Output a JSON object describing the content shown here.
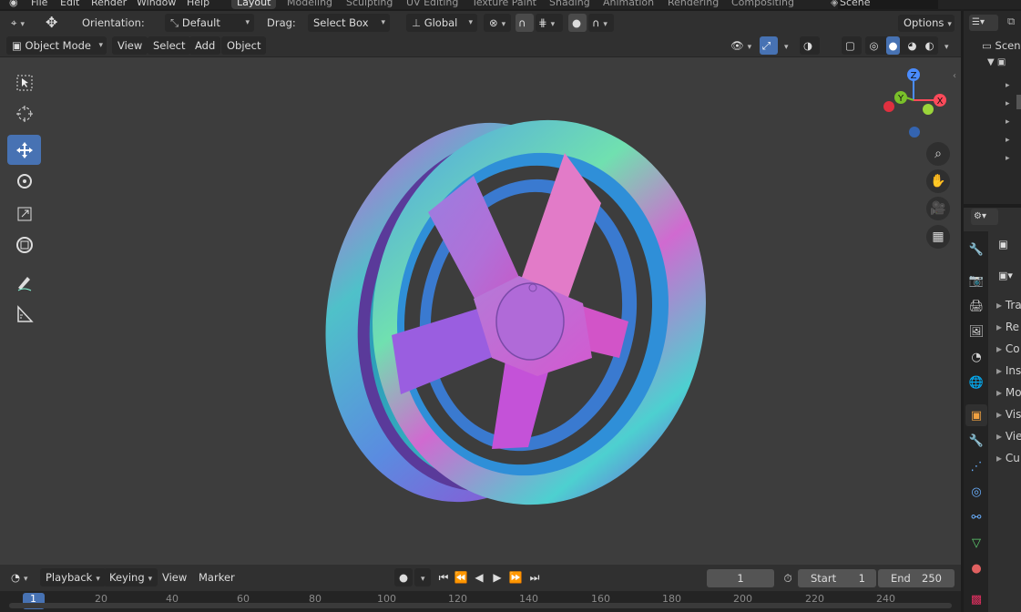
{
  "top_menu": [
    "File",
    "Edit",
    "Render",
    "Window",
    "Help"
  ],
  "workspaces": [
    "Layout",
    "Modeling",
    "Sculpting",
    "UV Editing",
    "Texture Paint",
    "Shading",
    "Animation",
    "Rendering",
    "Compositing"
  ],
  "scene_name": "Scene",
  "header": {
    "orientation_label": "Orientation:",
    "orientation_value": "Default",
    "drag_label": "Drag:",
    "drag_value": "Select Box",
    "transform_space": "Global",
    "options_label": "Options"
  },
  "header2": {
    "mode": "Object Mode",
    "menus": [
      "View",
      "Select",
      "Add",
      "Object"
    ]
  },
  "tools": [
    "select-box-icon",
    "cursor-icon",
    "move-icon",
    "rotate-icon",
    "scale-icon",
    "transform-icon",
    "annotate-icon",
    "measure-icon"
  ],
  "gizmo": {
    "z": "Z",
    "y": "Y",
    "x": "X"
  },
  "properties_rows": [
    "Tra",
    "Re",
    "Co",
    "Ins",
    "Mo",
    "Vis",
    "Vie",
    "Cu"
  ],
  "outliner_top": "Scen",
  "timeline": {
    "menus": [
      "Playback",
      "Keying",
      "View",
      "Marker"
    ],
    "current_frame": "1",
    "start_label": "Start",
    "start_value": "1",
    "end_label": "End",
    "end_value": "250",
    "ruler_marks": [
      "1",
      "20",
      "40",
      "60",
      "80",
      "100",
      "120",
      "140",
      "160",
      "180",
      "200",
      "220",
      "240"
    ]
  },
  "colors": {
    "accent": "#4772b3",
    "viewport_bg": "#3d3d3d",
    "header_bg": "#303030"
  }
}
